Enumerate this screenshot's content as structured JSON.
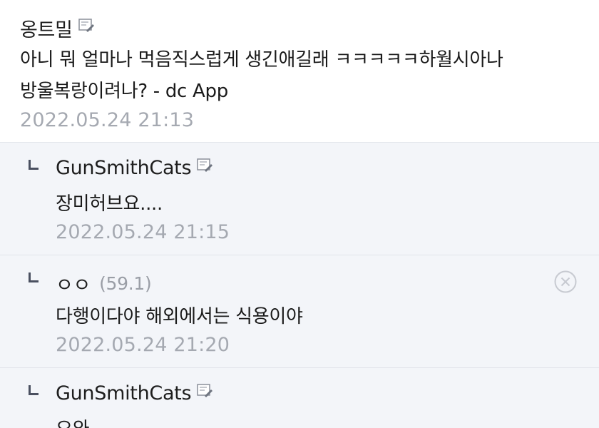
{
  "comments": [
    {
      "author": "옹트밀",
      "body_lines": [
        "아니 뭐 얼마나 먹음직스럽게 생긴애길래 ㅋㅋㅋㅋㅋ하월시아나",
        "방울복랑이려나? - dc App"
      ],
      "date": "2022.05.24 21:13"
    }
  ],
  "replies": [
    {
      "author": "GunSmithCats",
      "body": "장미허브요....",
      "date": "2022.05.24 21:15"
    },
    {
      "author": "ㅇㅇ",
      "ip": "(59.1)",
      "body": "다행이다야 해외에서는 식용이야",
      "date": "2022.05.24 21:20",
      "delete_icon": "close-circle-icon"
    },
    {
      "author": "GunSmithCats",
      "body": "오와"
    }
  ],
  "icons": {
    "gallog": "gallog-memo-icon",
    "reply": "reply-arrow-icon"
  }
}
